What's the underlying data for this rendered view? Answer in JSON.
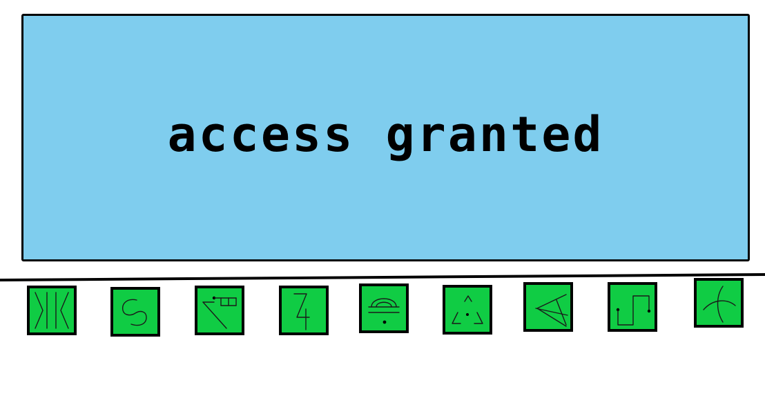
{
  "display": {
    "message": "access granted",
    "background_color": "#7fcdee"
  },
  "keypad": {
    "key_color": "#10cc44",
    "keys": [
      {
        "icon": "mirrored-k-glyph-icon"
      },
      {
        "icon": "s-curl-glyph-icon"
      },
      {
        "icon": "flag-ladder-glyph-icon"
      },
      {
        "icon": "zigzag-four-glyph-icon"
      },
      {
        "icon": "dome-dot-glyph-icon"
      },
      {
        "icon": "broken-triangle-dot-glyph-icon"
      },
      {
        "icon": "angle-wedge-glyph-icon"
      },
      {
        "icon": "square-wave-dots-glyph-icon"
      },
      {
        "icon": "crossed-arcs-glyph-icon"
      }
    ]
  }
}
